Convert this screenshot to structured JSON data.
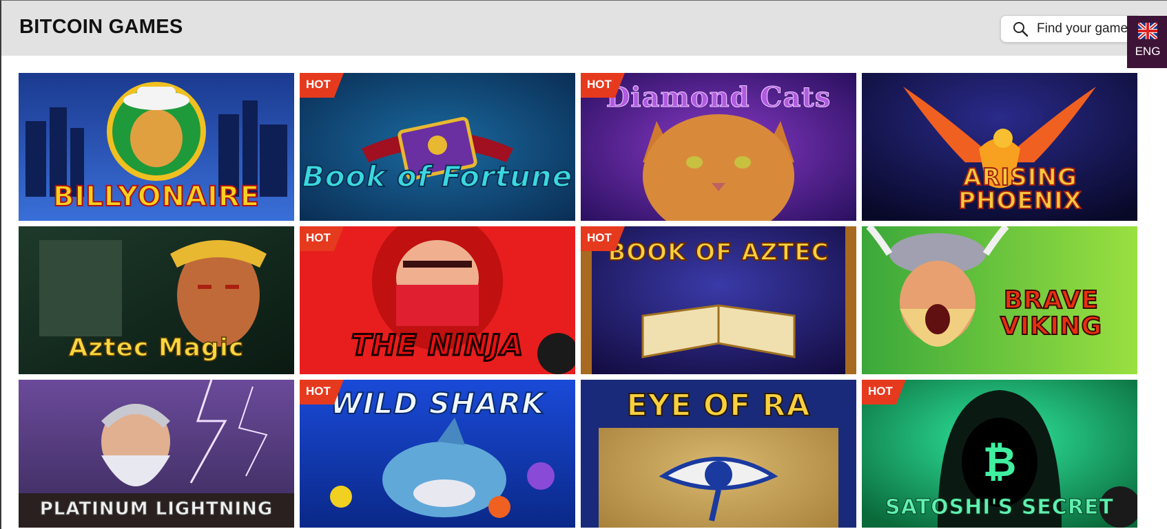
{
  "header": {
    "title": "BITCOIN GAMES"
  },
  "search": {
    "placeholder": "Find your game",
    "icon": "search-icon"
  },
  "language": {
    "label": "ENG",
    "icon": "uk-flag-icon"
  },
  "badge_text": "HOT",
  "games": [
    {
      "name": "BILLYONAIRE",
      "hot": false
    },
    {
      "name": "Book of Fortune",
      "hot": true
    },
    {
      "name": "Diamond Cats",
      "hot": true
    },
    {
      "name": "ARISING PHOENIX",
      "hot": false
    },
    {
      "name": "Aztec Magic",
      "hot": false
    },
    {
      "name": "THE NINJA",
      "hot": true
    },
    {
      "name": "BOOK OF AZTEC",
      "hot": true
    },
    {
      "name": "BRAVE VIKING",
      "hot": false
    },
    {
      "name": "PLATINUM LIGHTNING",
      "hot": false
    },
    {
      "name": "WILD SHARK",
      "hot": true
    },
    {
      "name": "EYE OF RA",
      "hot": false
    },
    {
      "name": "SATOSHI'S SECRET",
      "hot": true
    }
  ],
  "colors": {
    "badge": "#e63a1e",
    "header_bg": "#e2e2e2",
    "lang_bg": "#3d1437"
  }
}
